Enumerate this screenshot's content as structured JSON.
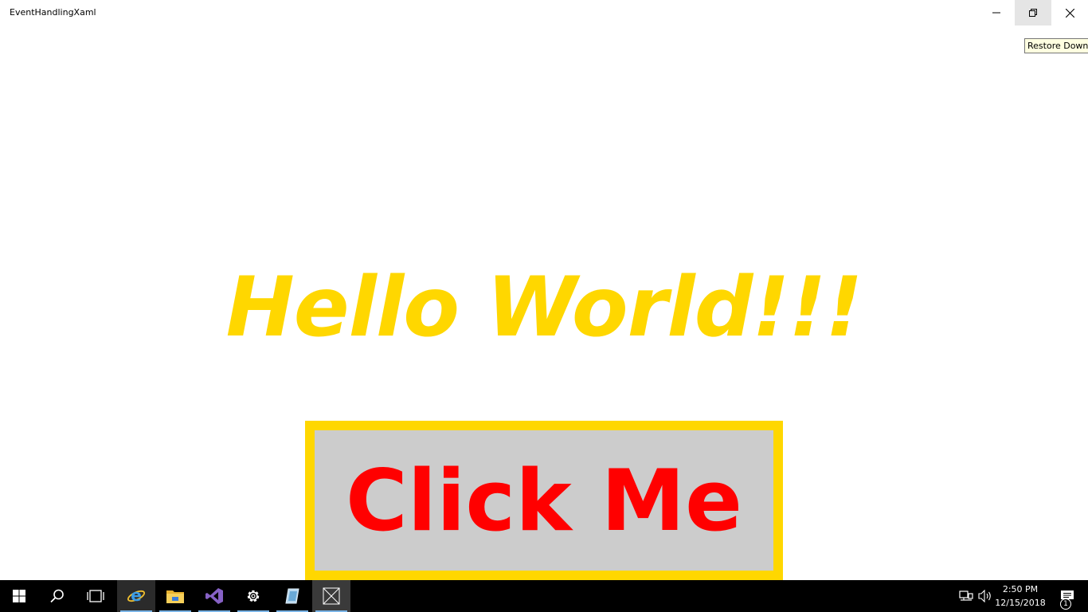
{
  "window": {
    "title": "EventHandlingXaml",
    "tooltip": "Restore Down"
  },
  "main": {
    "heading": "Hello World!!!",
    "button_label": "Click Me"
  },
  "taskbar": {
    "apps": [
      {
        "name": "start",
        "icon": "windows-logo-icon"
      },
      {
        "name": "search",
        "icon": "search-icon"
      },
      {
        "name": "task-view",
        "icon": "task-view-icon"
      },
      {
        "name": "internet-explorer",
        "icon": "internet-explorer-icon"
      },
      {
        "name": "file-explorer",
        "icon": "folder-icon"
      },
      {
        "name": "visual-studio",
        "icon": "visual-studio-icon"
      },
      {
        "name": "settings",
        "icon": "gear-icon"
      },
      {
        "name": "app",
        "icon": "app-icon"
      },
      {
        "name": "running-app",
        "icon": "placeholder-app-icon"
      }
    ],
    "clock": {
      "time": "2:50 PM",
      "date": "12/15/2018"
    },
    "notification_count": "1"
  },
  "colors": {
    "heading": "#ffd700",
    "button_border": "#ffd700",
    "button_background": "#cccccc",
    "button_text": "#ff0000",
    "taskbar": "#000000"
  }
}
